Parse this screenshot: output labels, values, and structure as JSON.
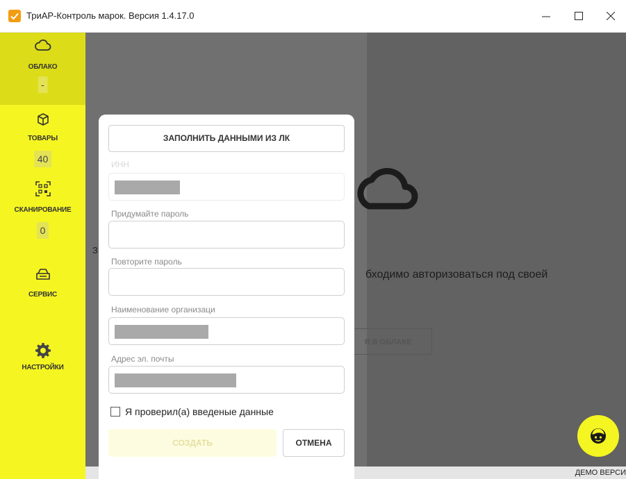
{
  "window": {
    "title": "ТриАР-Контроль марок. Версия 1.4.17.0"
  },
  "sidebar": {
    "items": [
      {
        "label": "ОБЛАКО",
        "badge": "-",
        "icon": "cloud-icon",
        "active": true
      },
      {
        "label": "ТОВАРЫ",
        "badge": "40",
        "icon": "box-icon"
      },
      {
        "label": "СКАНИРОВАНИЕ",
        "badge": "0",
        "icon": "qr-scan-icon"
      },
      {
        "label": "СЕРВИС",
        "icon": "service-icon"
      },
      {
        "label": "НАСТРОЙКИ",
        "icon": "gear-icon"
      }
    ]
  },
  "background": {
    "auth_text": "бходимо авторизоваться под своей",
    "cloud_button": "Я В ОБЛАКЕ",
    "fragment": "З"
  },
  "dialog": {
    "fill_button": "ЗАПОЛНИТЬ ДАННЫМИ ИЗ ЛК",
    "fields": [
      {
        "label": "ИНН",
        "value": "",
        "disabled": true
      },
      {
        "label": "Придумайте пароль",
        "value": ""
      },
      {
        "label": "Повторите пароль",
        "value": ""
      },
      {
        "label": "Наименование организаци",
        "value": ""
      },
      {
        "label": "Адрес эл. почты",
        "value": ""
      }
    ],
    "checkbox_label": "Я проверил(а) введеные данные",
    "checkbox_checked": false,
    "create_button": "СОЗДАТЬ",
    "cancel_button": "ОТМЕНА"
  },
  "statusbar": {
    "demo_text": "ДЕМО ВЕРСИ"
  },
  "support": {
    "icon": "support-agent-icon"
  },
  "colors": {
    "accent": "#f5f522",
    "app_icon": "#f39c12"
  }
}
